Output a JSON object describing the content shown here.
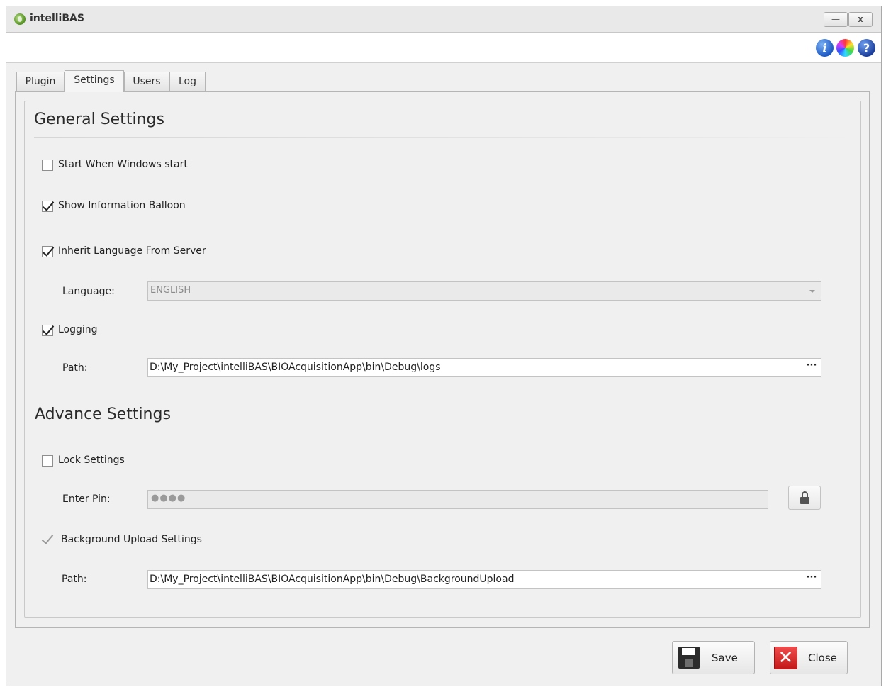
{
  "window": {
    "title": "intelliBAS",
    "minimize_glyph": "—",
    "close_glyph": "x"
  },
  "toolbar": {
    "icons": [
      "info-icon",
      "color-wheel-icon",
      "help-icon"
    ],
    "info_glyph": "i",
    "help_glyph": "?"
  },
  "tabs": [
    {
      "label": "Plugin",
      "active": false
    },
    {
      "label": "Settings",
      "active": true
    },
    {
      "label": "Users",
      "active": false
    },
    {
      "label": "Log",
      "active": false
    }
  ],
  "general": {
    "title": "General Settings",
    "start_with_windows": {
      "label": "Start When Windows start",
      "checked": false
    },
    "show_info_balloon": {
      "label": "Show Information Balloon",
      "checked": true
    },
    "inherit_language": {
      "label": "Inherit Language From Server",
      "checked": true
    },
    "language": {
      "label": "Language:",
      "value": "ENGLISH",
      "disabled": true
    },
    "logging": {
      "label": "Logging",
      "checked": true
    },
    "log_path": {
      "label": "Path:",
      "value": "D:\\My_Project\\intelliBAS\\BIOAcquisitionApp\\bin\\Debug\\logs"
    }
  },
  "advance": {
    "title": "Advance Settings",
    "lock_settings": {
      "label": "Lock Settings",
      "checked": false
    },
    "pin": {
      "label": "Enter Pin:",
      "value": "●●●●",
      "disabled": true
    },
    "background_upload": {
      "label": "Background Upload Settings",
      "checked": true,
      "disabled": true
    },
    "upload_path": {
      "label": "Path:",
      "value": "D:\\My_Project\\intelliBAS\\BIOAcquisitionApp\\bin\\Debug\\BackgroundUpload"
    }
  },
  "ellipsis_label": "···",
  "buttons": {
    "save_label": "Save",
    "close_label": "Close",
    "close_glyph": "✕"
  },
  "colors": {
    "window_bg": "#f0f0f0",
    "close_icon_red": "#d92424",
    "info_blue": "#1e5bc4"
  }
}
